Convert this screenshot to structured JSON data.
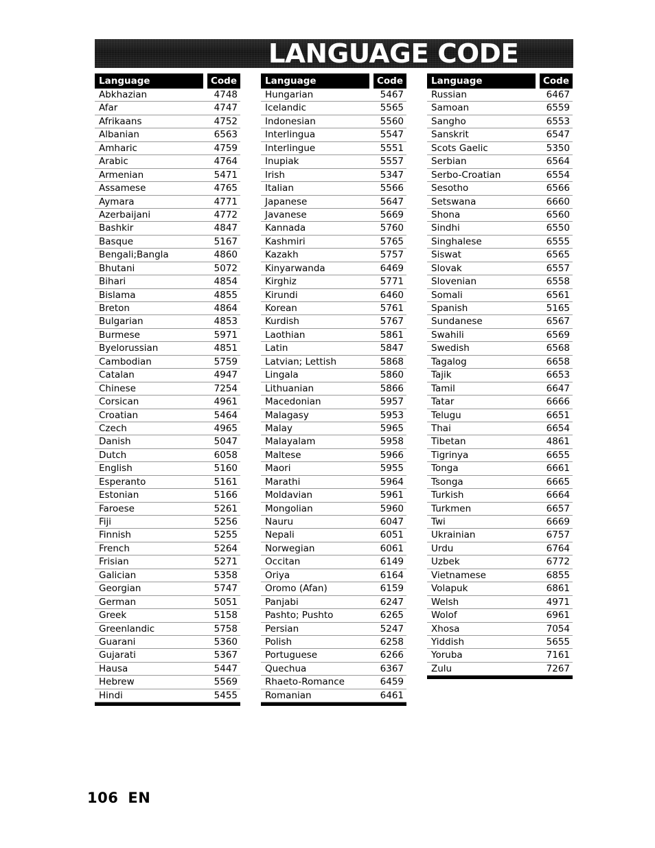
{
  "page": {
    "title": "LANGUAGE CODE",
    "footer_page_number": "106",
    "footer_language_label": "EN",
    "colors": {
      "header_background": "#000000",
      "header_text": "#ffffff",
      "banner_background": "#1b1b1b",
      "row_rule": "#9a9a9a",
      "table_bottom_rule": "#000000",
      "body_text": "#000000",
      "page_background": "#ffffff"
    }
  },
  "table": {
    "headers": {
      "language": "Language",
      "code": "Code"
    },
    "columns": [
      {
        "id": "column-1",
        "rows": [
          {
            "language": "Abkhazian",
            "code": "4748"
          },
          {
            "language": "Afar",
            "code": "4747"
          },
          {
            "language": "Afrikaans",
            "code": "4752"
          },
          {
            "language": "Albanian",
            "code": "6563"
          },
          {
            "language": "Amharic",
            "code": "4759"
          },
          {
            "language": "Arabic",
            "code": "4764"
          },
          {
            "language": "Armenian",
            "code": "5471"
          },
          {
            "language": "Assamese",
            "code": "4765"
          },
          {
            "language": "Aymara",
            "code": "4771"
          },
          {
            "language": "Azerbaijani",
            "code": "4772"
          },
          {
            "language": "Bashkir",
            "code": "4847"
          },
          {
            "language": "Basque",
            "code": "5167"
          },
          {
            "language": "Bengali;Bangla",
            "code": "4860"
          },
          {
            "language": "Bhutani",
            "code": "5072"
          },
          {
            "language": "Bihari",
            "code": "4854"
          },
          {
            "language": "Bislama",
            "code": "4855"
          },
          {
            "language": "Breton",
            "code": "4864"
          },
          {
            "language": "Bulgarian",
            "code": "4853"
          },
          {
            "language": "Burmese",
            "code": "5971"
          },
          {
            "language": "Byelorussian",
            "code": "4851"
          },
          {
            "language": "Cambodian",
            "code": "5759"
          },
          {
            "language": "Catalan",
            "code": "4947"
          },
          {
            "language": "Chinese",
            "code": "7254"
          },
          {
            "language": "Corsican",
            "code": "4961"
          },
          {
            "language": "Croatian",
            "code": "5464"
          },
          {
            "language": "Czech",
            "code": "4965"
          },
          {
            "language": "Danish",
            "code": "5047"
          },
          {
            "language": "Dutch",
            "code": "6058"
          },
          {
            "language": "English",
            "code": "5160"
          },
          {
            "language": "Esperanto",
            "code": "5161"
          },
          {
            "language": "Estonian",
            "code": "5166"
          },
          {
            "language": "Faroese",
            "code": "5261"
          },
          {
            "language": "Fiji",
            "code": "5256"
          },
          {
            "language": "Finnish",
            "code": "5255"
          },
          {
            "language": "French",
            "code": "5264"
          },
          {
            "language": "Frisian",
            "code": "5271"
          },
          {
            "language": "Galician",
            "code": "5358"
          },
          {
            "language": "Georgian",
            "code": "5747"
          },
          {
            "language": "German",
            "code": "5051"
          },
          {
            "language": "Greek",
            "code": "5158"
          },
          {
            "language": "Greenlandic",
            "code": "5758"
          },
          {
            "language": "Guarani",
            "code": "5360"
          },
          {
            "language": "Gujarati",
            "code": "5367"
          },
          {
            "language": "Hausa",
            "code": "5447"
          },
          {
            "language": "Hebrew",
            "code": "5569"
          },
          {
            "language": "Hindi",
            "code": "5455"
          }
        ]
      },
      {
        "id": "column-2",
        "rows": [
          {
            "language": "Hungarian",
            "code": "5467"
          },
          {
            "language": "Icelandic",
            "code": "5565"
          },
          {
            "language": "Indonesian",
            "code": "5560"
          },
          {
            "language": "Interlingua",
            "code": "5547"
          },
          {
            "language": "Interlingue",
            "code": "5551"
          },
          {
            "language": "Inupiak",
            "code": "5557"
          },
          {
            "language": "Irish",
            "code": "5347"
          },
          {
            "language": "Italian",
            "code": "5566"
          },
          {
            "language": "Japanese",
            "code": "5647"
          },
          {
            "language": "Javanese",
            "code": "5669"
          },
          {
            "language": "Kannada",
            "code": "5760"
          },
          {
            "language": "Kashmiri",
            "code": "5765"
          },
          {
            "language": "Kazakh",
            "code": "5757"
          },
          {
            "language": "Kinyarwanda",
            "code": "6469"
          },
          {
            "language": "Kirghiz",
            "code": "5771"
          },
          {
            "language": "Kirundi",
            "code": "6460"
          },
          {
            "language": "Korean",
            "code": "5761"
          },
          {
            "language": "Kurdish",
            "code": "5767"
          },
          {
            "language": "Laothian",
            "code": "5861"
          },
          {
            "language": "Latin",
            "code": "5847"
          },
          {
            "language": "Latvian; Lettish",
            "code": "5868"
          },
          {
            "language": "Lingala",
            "code": "5860"
          },
          {
            "language": "Lithuanian",
            "code": "5866"
          },
          {
            "language": "Macedonian",
            "code": "5957"
          },
          {
            "language": "Malagasy",
            "code": "5953"
          },
          {
            "language": "Malay",
            "code": "5965"
          },
          {
            "language": "Malayalam",
            "code": "5958"
          },
          {
            "language": "Maltese",
            "code": "5966"
          },
          {
            "language": "Maori",
            "code": "5955"
          },
          {
            "language": "Marathi",
            "code": "5964"
          },
          {
            "language": "Moldavian",
            "code": "5961"
          },
          {
            "language": "Mongolian",
            "code": "5960"
          },
          {
            "language": "Nauru",
            "code": "6047"
          },
          {
            "language": "Nepali",
            "code": "6051"
          },
          {
            "language": "Norwegian",
            "code": "6061"
          },
          {
            "language": "Occitan",
            "code": "6149"
          },
          {
            "language": "Oriya",
            "code": "6164"
          },
          {
            "language": "Oromo (Afan)",
            "code": "6159"
          },
          {
            "language": "Panjabi",
            "code": "6247"
          },
          {
            "language": "Pashto; Pushto",
            "code": "6265"
          },
          {
            "language": "Persian",
            "code": "5247"
          },
          {
            "language": "Polish",
            "code": "6258"
          },
          {
            "language": "Portuguese",
            "code": "6266"
          },
          {
            "language": "Quechua",
            "code": "6367"
          },
          {
            "language": "Rhaeto-Romance",
            "code": "6459"
          },
          {
            "language": "Romanian",
            "code": "6461"
          }
        ]
      },
      {
        "id": "column-3",
        "rows": [
          {
            "language": "Russian",
            "code": "6467"
          },
          {
            "language": "Samoan",
            "code": "6559"
          },
          {
            "language": "Sangho",
            "code": "6553"
          },
          {
            "language": "Sanskrit",
            "code": "6547"
          },
          {
            "language": "Scots Gaelic",
            "code": "5350"
          },
          {
            "language": "Serbian",
            "code": "6564"
          },
          {
            "language": "Serbo-Croatian",
            "code": "6554"
          },
          {
            "language": "Sesotho",
            "code": "6566"
          },
          {
            "language": "Setswana",
            "code": "6660"
          },
          {
            "language": "Shona",
            "code": "6560"
          },
          {
            "language": "Sindhi",
            "code": "6550"
          },
          {
            "language": "Singhalese",
            "code": "6555"
          },
          {
            "language": "Siswat",
            "code": "6565"
          },
          {
            "language": "Slovak",
            "code": "6557"
          },
          {
            "language": "Slovenian",
            "code": "6558"
          },
          {
            "language": "Somali",
            "code": "6561"
          },
          {
            "language": "Spanish",
            "code": "5165"
          },
          {
            "language": "Sundanese",
            "code": "6567"
          },
          {
            "language": "Swahili",
            "code": "6569"
          },
          {
            "language": "Swedish",
            "code": "6568"
          },
          {
            "language": "Tagalog",
            "code": "6658"
          },
          {
            "language": "Tajik",
            "code": "6653"
          },
          {
            "language": "Tamil",
            "code": "6647"
          },
          {
            "language": "Tatar",
            "code": "6666"
          },
          {
            "language": "Telugu",
            "code": "6651"
          },
          {
            "language": "Thai",
            "code": "6654"
          },
          {
            "language": "Tibetan",
            "code": "4861"
          },
          {
            "language": "Tigrinya",
            "code": "6655"
          },
          {
            "language": "Tonga",
            "code": "6661"
          },
          {
            "language": "Tsonga",
            "code": "6665"
          },
          {
            "language": "Turkish",
            "code": "6664"
          },
          {
            "language": "Turkmen",
            "code": "6657"
          },
          {
            "language": "Twi",
            "code": "6669"
          },
          {
            "language": "Ukrainian",
            "code": "6757"
          },
          {
            "language": "Urdu",
            "code": "6764"
          },
          {
            "language": "Uzbek",
            "code": "6772"
          },
          {
            "language": "Vietnamese",
            "code": "6855"
          },
          {
            "language": "Volapuk",
            "code": "6861"
          },
          {
            "language": "Welsh",
            "code": "4971"
          },
          {
            "language": "Wolof",
            "code": "6961"
          },
          {
            "language": "Xhosa",
            "code": "7054"
          },
          {
            "language": "Yiddish",
            "code": "5655"
          },
          {
            "language": "Yoruba",
            "code": "7161"
          },
          {
            "language": "Zulu",
            "code": "7267"
          }
        ]
      }
    ]
  }
}
